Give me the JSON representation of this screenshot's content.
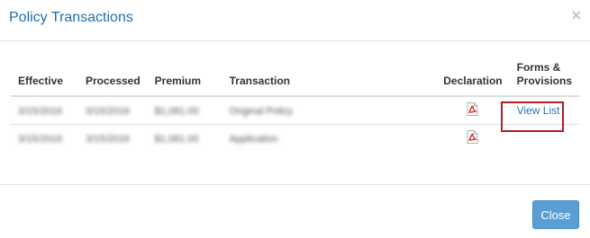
{
  "dialog": {
    "title": "Policy Transactions",
    "close_glyph": "×"
  },
  "table": {
    "headers": {
      "effective": "Effective",
      "processed": "Processed",
      "premium": "Premium",
      "transaction": "Transaction",
      "declaration": "Declaration",
      "forms_line1": "Forms &",
      "forms_line2": "Provisions"
    },
    "rows": [
      {
        "effective": "3/15/2016",
        "processed": "3/15/2016",
        "premium": "$1,081.00",
        "transaction": "Original Policy",
        "declaration_icon": "pdf-icon",
        "forms_link": "View List"
      },
      {
        "effective": "3/15/2016",
        "processed": "3/15/2016",
        "premium": "$1,081.00",
        "transaction": "Application",
        "declaration_icon": "pdf-icon",
        "forms_link": ""
      }
    ]
  },
  "footer": {
    "close_label": "Close"
  },
  "colors": {
    "title": "#1f6fae",
    "link": "#2a72b5",
    "highlight": "#b01e2a",
    "button": "#5a9fd4"
  }
}
